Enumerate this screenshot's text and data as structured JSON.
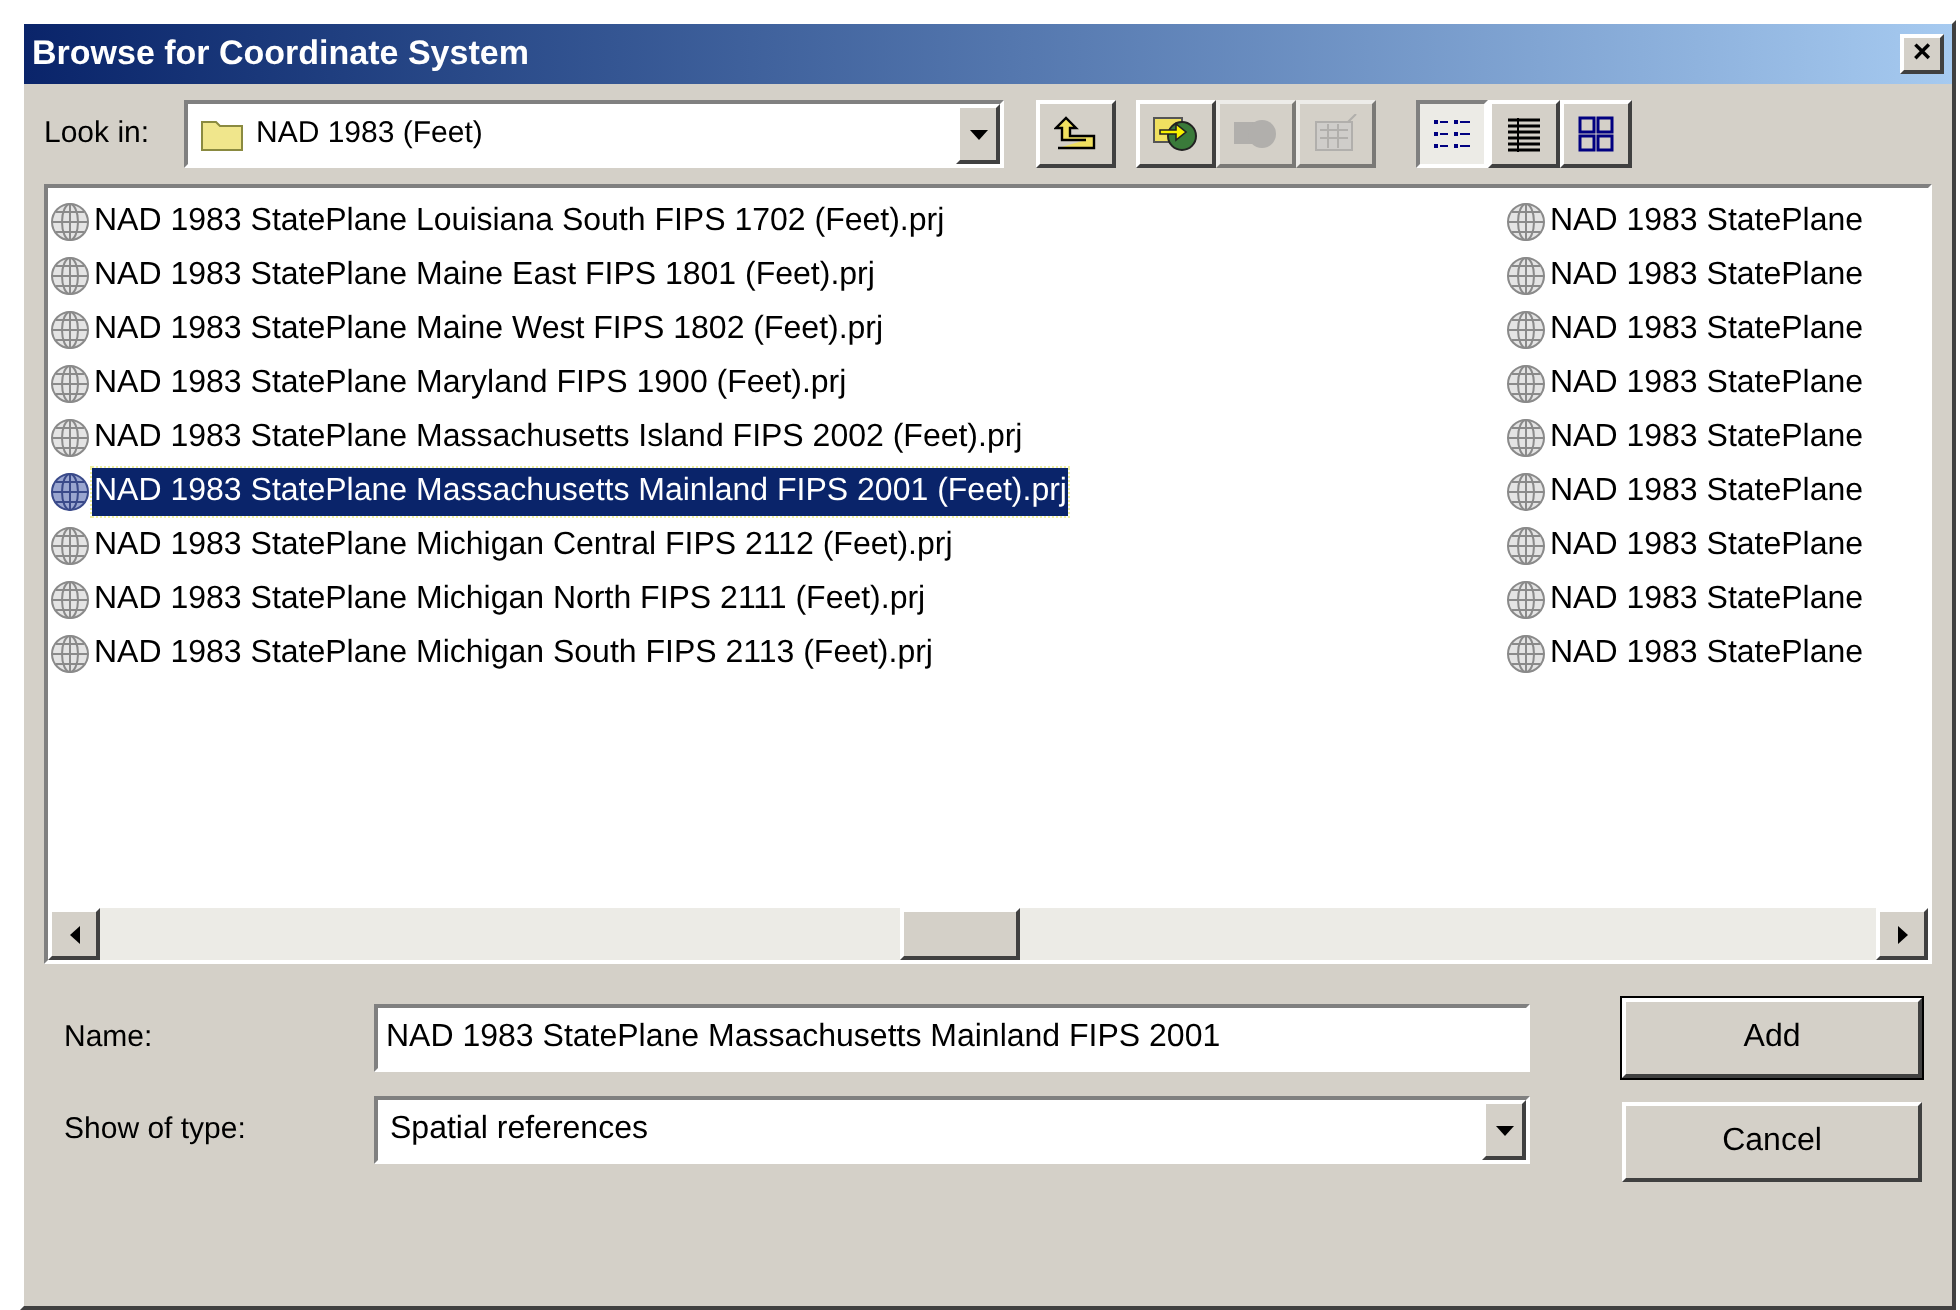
{
  "window": {
    "title": "Browse for Coordinate System",
    "close": "×"
  },
  "look_in": {
    "label": "Look in:",
    "value": "NAD 1983 (Feet)"
  },
  "toolbar": [
    {
      "kind": "up",
      "disabled": false
    },
    {
      "kind": "connect",
      "disabled": false
    },
    {
      "kind": "disconnect",
      "disabled": true
    },
    {
      "kind": "properties",
      "disabled": true
    }
  ],
  "views": [
    {
      "kind": "list",
      "selected": true
    },
    {
      "kind": "details",
      "selected": false
    },
    {
      "kind": "thumbnails",
      "selected": false
    }
  ],
  "files": {
    "columns": [
      [
        {
          "name": "NAD 1983 StatePlane Louisiana South FIPS 1702 (Feet).prj",
          "selected": false
        },
        {
          "name": "NAD 1983 StatePlane Maine East FIPS 1801 (Feet).prj",
          "selected": false
        },
        {
          "name": "NAD 1983 StatePlane Maine West FIPS 1802 (Feet).prj",
          "selected": false
        },
        {
          "name": "NAD 1983 StatePlane Maryland FIPS 1900 (Feet).prj",
          "selected": false
        },
        {
          "name": "NAD 1983 StatePlane Massachusetts Island FIPS 2002 (Feet).prj",
          "selected": false
        },
        {
          "name": "NAD 1983 StatePlane Massachusetts Mainland FIPS 2001 (Feet).prj",
          "selected": true
        },
        {
          "name": "NAD 1983 StatePlane Michigan Central FIPS 2112 (Feet).prj",
          "selected": false
        },
        {
          "name": "NAD 1983 StatePlane Michigan North FIPS 2111 (Feet).prj",
          "selected": false
        },
        {
          "name": "NAD 1983 StatePlane Michigan South FIPS 2113 (Feet).prj",
          "selected": false
        }
      ],
      [
        {
          "name": "NAD 1983 StatePlane",
          "selected": false
        },
        {
          "name": "NAD 1983 StatePlane",
          "selected": false
        },
        {
          "name": "NAD 1983 StatePlane",
          "selected": false
        },
        {
          "name": "NAD 1983 StatePlane",
          "selected": false
        },
        {
          "name": "NAD 1983 StatePlane",
          "selected": false
        },
        {
          "name": "NAD 1983 StatePlane",
          "selected": false
        },
        {
          "name": "NAD 1983 StatePlane",
          "selected": false
        },
        {
          "name": "NAD 1983 StatePlane",
          "selected": false
        },
        {
          "name": "NAD 1983 StatePlane",
          "selected": false
        }
      ]
    ]
  },
  "name_field": {
    "label": "Name:",
    "value": "NAD 1983 StatePlane Massachusetts Mainland FIPS 2001"
  },
  "type_field": {
    "label": "Show of type:",
    "value": "Spatial references"
  },
  "buttons": [
    {
      "label": "Add",
      "default": true
    },
    {
      "label": "Cancel",
      "default": false
    }
  ]
}
